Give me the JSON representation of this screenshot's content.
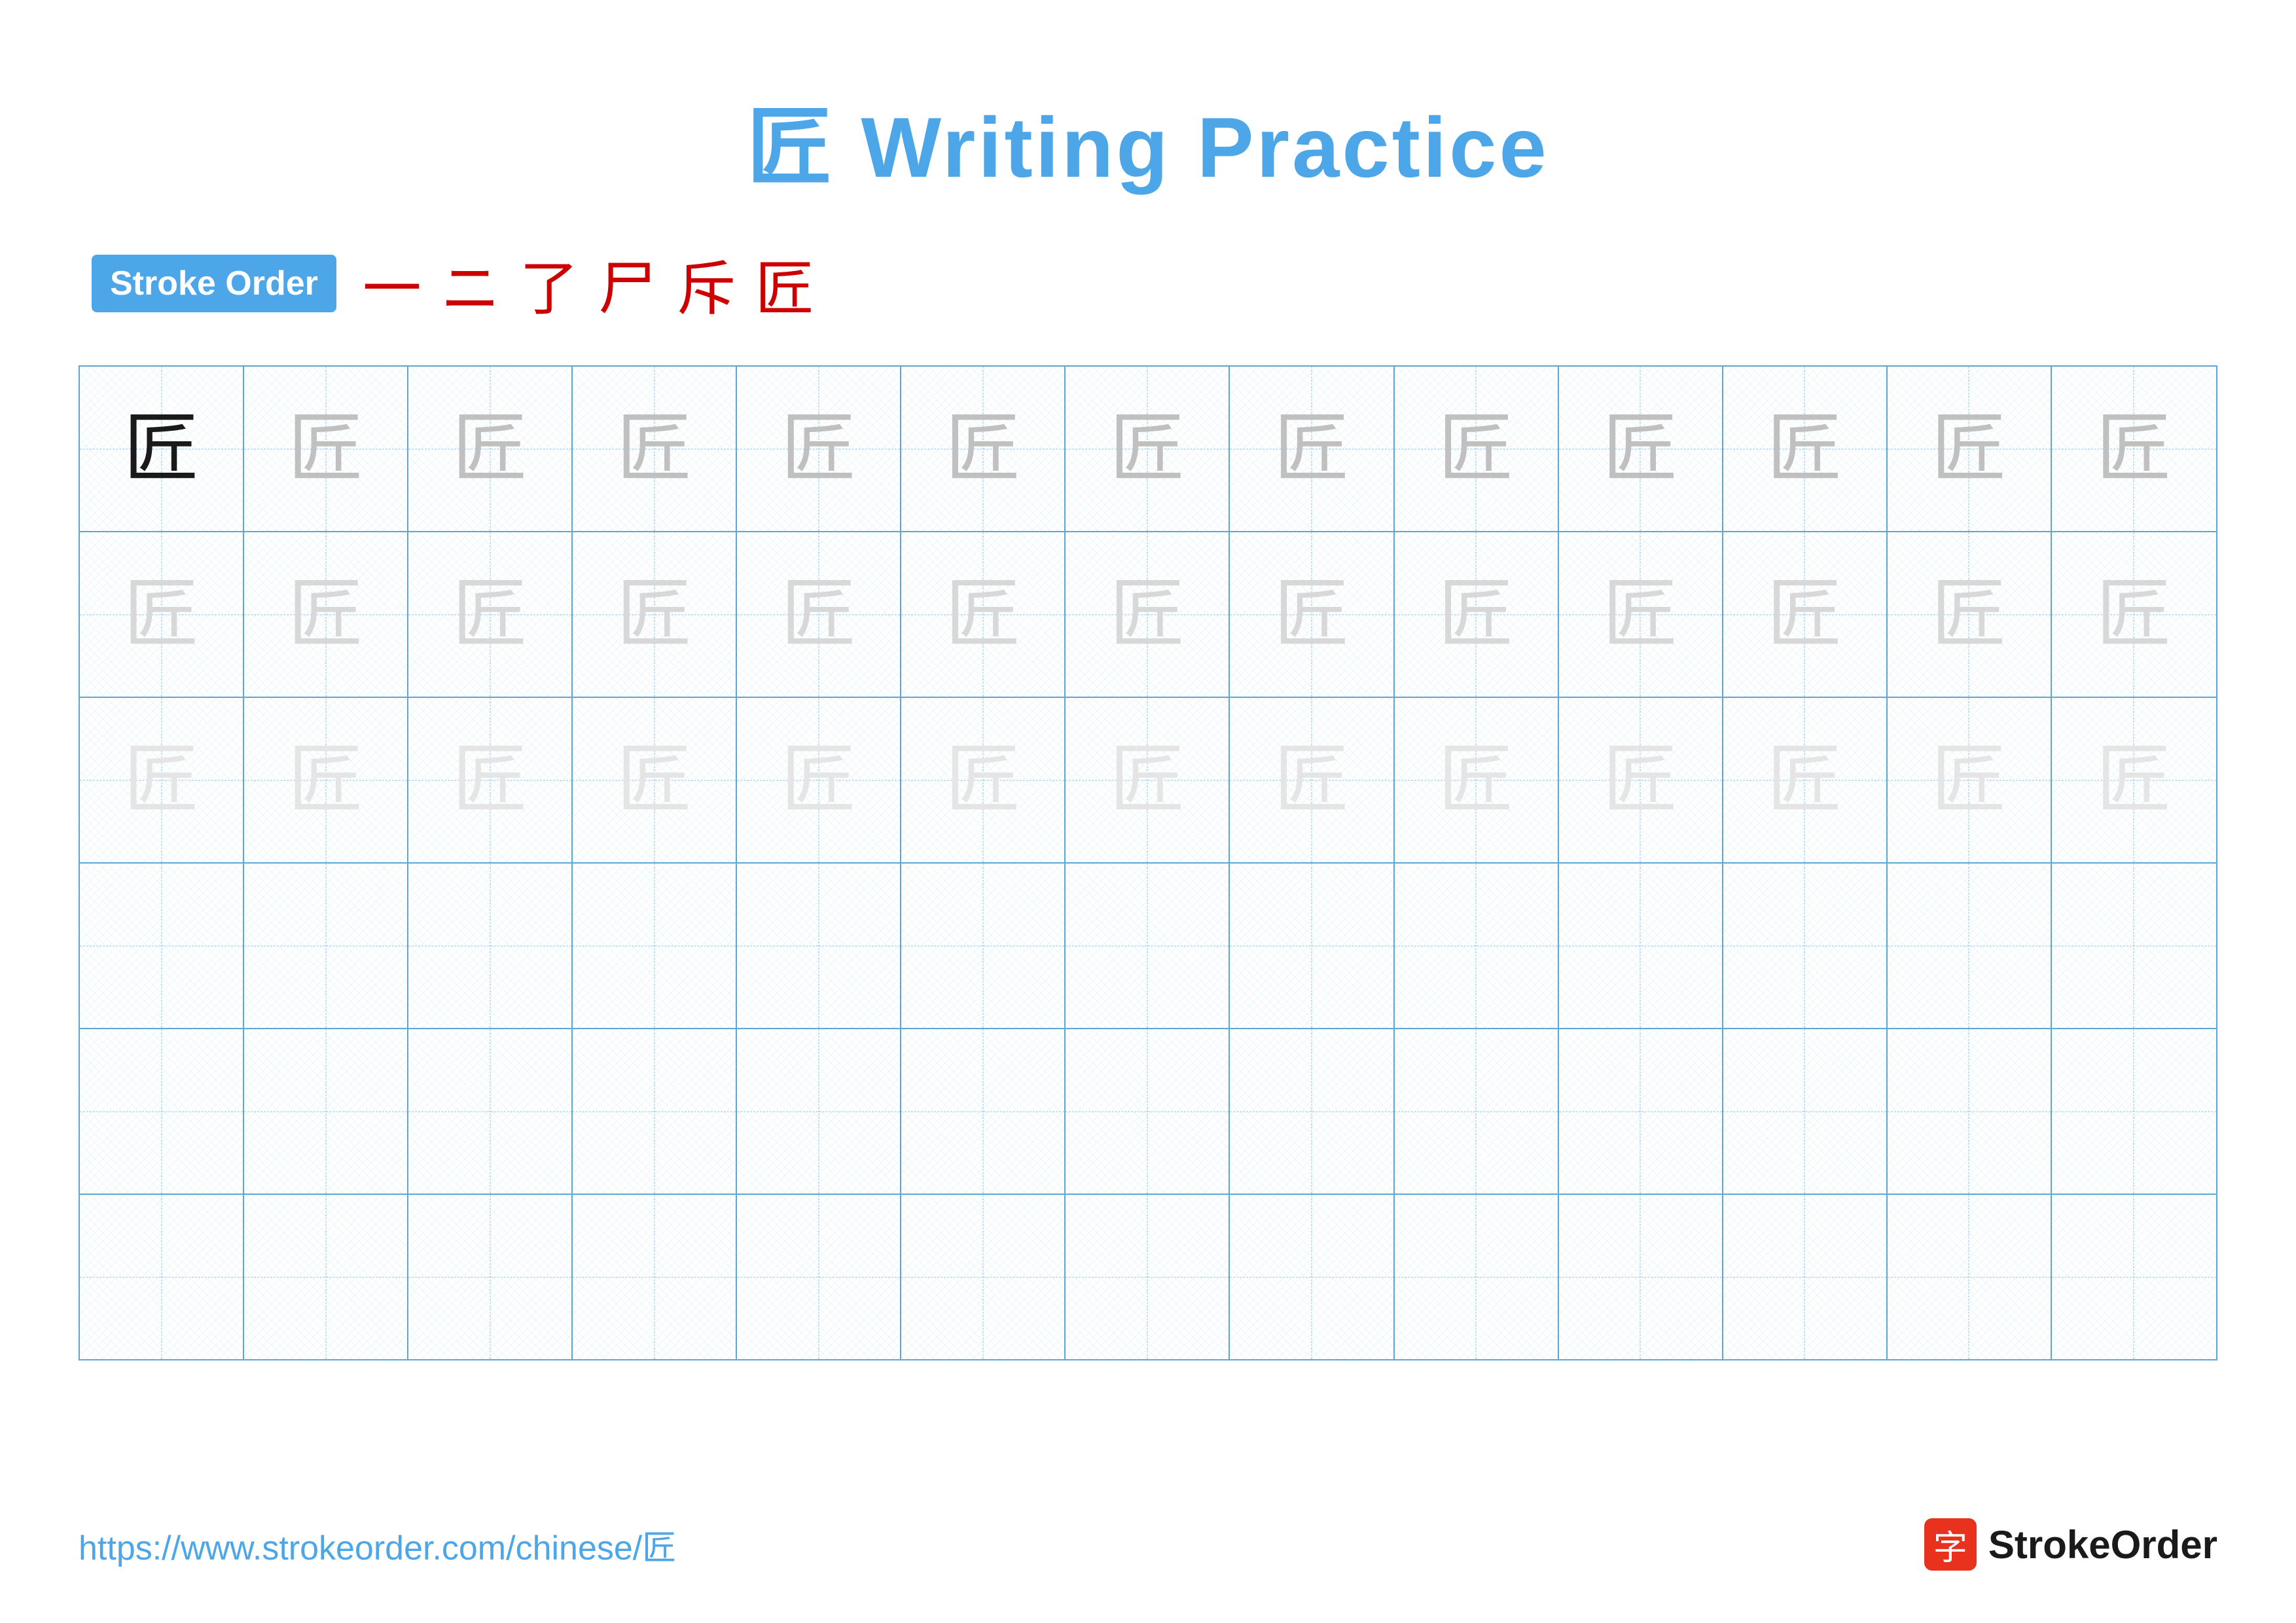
{
  "title": {
    "character": "匠",
    "rest": " Writing Practice",
    "full": "匠 Writing Practice"
  },
  "stroke_order": {
    "badge_label": "Stroke Order",
    "strokes": [
      "一",
      "ニ",
      "了",
      "尸",
      "斥",
      "匠"
    ]
  },
  "grid": {
    "rows": 6,
    "cols": 13,
    "character": "匠",
    "row_configs": [
      {
        "type": "dark",
        "count": 1,
        "rest_type": "medium"
      },
      {
        "type": "light",
        "count": 13
      },
      {
        "type": "lighter",
        "count": 13
      },
      {
        "type": "empty",
        "count": 13
      },
      {
        "type": "empty",
        "count": 13
      },
      {
        "type": "empty",
        "count": 13
      }
    ]
  },
  "footer": {
    "url": "https://www.strokeorder.com/chinese/匠",
    "logo_char": "字",
    "logo_text": "StrokeOrder"
  }
}
